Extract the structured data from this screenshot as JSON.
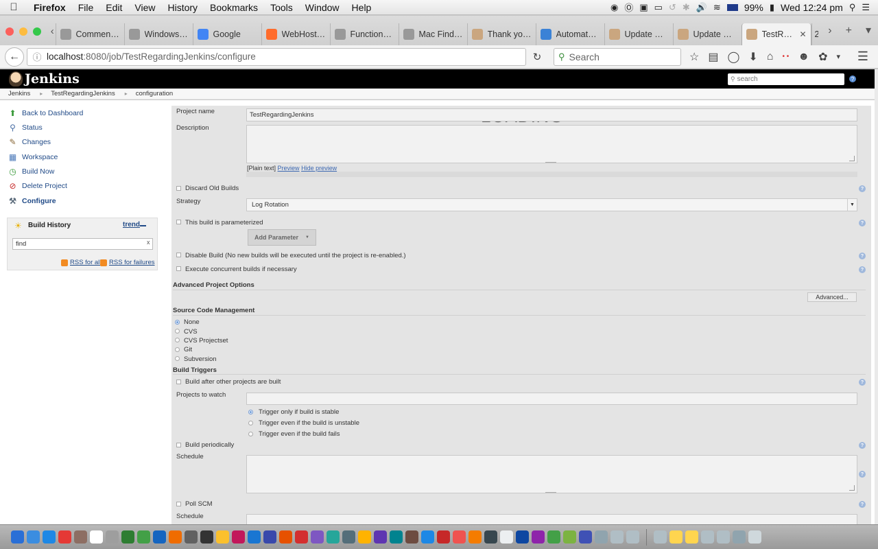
{
  "menubar": {
    "app": "Firefox",
    "items": [
      "File",
      "Edit",
      "View",
      "History",
      "Bookmarks",
      "Tools",
      "Window",
      "Help"
    ],
    "battery": "99%",
    "clock": "Wed 12:24 pm"
  },
  "tabs": [
    {
      "label": "Commen…",
      "icon": "generic-page-icon",
      "color": "#999999"
    },
    {
      "label": "Windows…",
      "icon": "generic-page-icon",
      "color": "#999999"
    },
    {
      "label": "Google",
      "icon": "google-icon",
      "color": "#4285f4"
    },
    {
      "label": "WebHost…",
      "icon": "cpanel-icon",
      "color": "#ff6c2c"
    },
    {
      "label": "Function…",
      "icon": "generic-page-icon",
      "color": "#999999"
    },
    {
      "label": "Mac Find…",
      "icon": "generic-page-icon",
      "color": "#999999"
    },
    {
      "label": "Thank yo…",
      "icon": "jenkins-icon",
      "color": "#caa67f"
    },
    {
      "label": "Automate…",
      "icon": "c-icon",
      "color": "#3b82d6"
    },
    {
      "label": "Update C…",
      "icon": "jenkins-icon",
      "color": "#caa67f"
    },
    {
      "label": "Update C…",
      "icon": "jenkins-icon",
      "color": "#caa67f"
    },
    {
      "label": "TestR…",
      "icon": "jenkins-icon",
      "color": "#caa67f",
      "active": true
    }
  ],
  "tab_overflow": "2",
  "navbar": {
    "url_host": "localhost",
    "url_path": ":8080/job/TestRegardingJenkins/configure",
    "search_placeholder": "Search"
  },
  "jenkins": {
    "brand": "Jenkins",
    "search_placeholder": "search",
    "breadcrumb": [
      "Jenkins",
      "TestRegardingJenkins",
      "configuration"
    ],
    "tasks": [
      {
        "label": "Back to Dashboard",
        "icon": "up-arrow-icon"
      },
      {
        "label": "Status",
        "icon": "magnifier-icon"
      },
      {
        "label": "Changes",
        "icon": "notepad-icon"
      },
      {
        "label": "Workspace",
        "icon": "folder-icon"
      },
      {
        "label": "Build Now",
        "icon": "clock-play-icon"
      },
      {
        "label": "Delete Project",
        "icon": "no-entry-icon"
      },
      {
        "label": "Configure",
        "icon": "wrench-icon",
        "active": true
      }
    ],
    "build_history": {
      "title": "Build History",
      "trend": "trend",
      "find_value": "find",
      "rss_all": "RSS for all",
      "rss_failures": "RSS for failures"
    }
  },
  "config": {
    "loading": "LOADING",
    "project_name_label": "Project name",
    "project_name_value": "TestRegardingJenkins",
    "description_label": "Description",
    "description_links": {
      "plain": "[Plain text]",
      "preview": "Preview",
      "hide": "Hide preview"
    },
    "discard_old_builds": "Discard Old Builds",
    "strategy_label": "Strategy",
    "strategy_value": "Log Rotation",
    "parameterized": "This build is parameterized",
    "add_parameter": "Add Parameter",
    "disable_build": "Disable Build (No new builds will be executed until the project is re-enabled.)",
    "concurrent": "Execute concurrent builds if necessary",
    "advanced_section": "Advanced Project Options",
    "advanced_button": "Advanced...",
    "scm_section": "Source Code Management",
    "scm_options": [
      "None",
      "CVS",
      "CVS Projectset",
      "Git",
      "Subversion"
    ],
    "scm_selected": "None",
    "triggers_section": "Build Triggers",
    "build_after": "Build after other projects are built",
    "projects_to_watch": "Projects to watch",
    "trigger_options": [
      "Trigger only if build is stable",
      "Trigger even if the build is unstable",
      "Trigger even if the build fails"
    ],
    "trigger_selected": "Trigger only if build is stable",
    "build_periodically": "Build periodically",
    "schedule_label": "Schedule",
    "poll_scm": "Poll SCM",
    "schedule_label_2": "Schedule"
  },
  "colors": {
    "jenkins_header": "#000000",
    "link": "#204a87",
    "form_bg": "#e4e4e4",
    "help_icon": "#9fb8dc"
  }
}
